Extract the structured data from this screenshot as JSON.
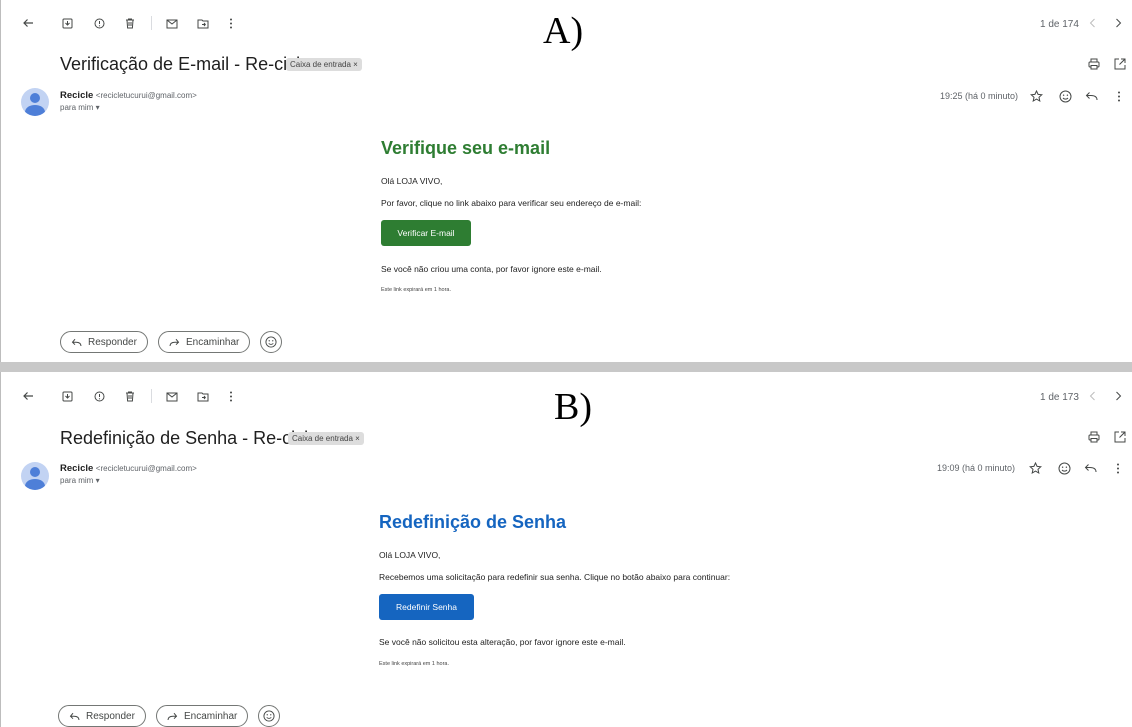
{
  "panels": [
    {
      "caption": "A)",
      "counter": "1 de 174",
      "subject": "Verificação de E-mail - Re-ciclo",
      "label": "Caixa de entrada ×",
      "sender_name": "Recicle",
      "sender_email": "<recicletucurui@gmail.com>",
      "to_me": "para mim ▾",
      "time": "19:25 (há 0 minuto)",
      "heading": "Verifique seu e-mail",
      "greeting": "Olá LOJA VIVO,",
      "instruction": "Por favor, clique no link abaixo para verificar seu endereço de e-mail:",
      "button": "Verificar E-mail",
      "ignore": "Se você não criou uma conta, por favor ignore este e-mail.",
      "expiry": "Este link expirará em 1 hora.",
      "reply": "Responder",
      "forward": "Encaminhar"
    },
    {
      "caption": "B)",
      "counter": "1 de 173",
      "subject": "Redefinição de Senha - Re-ciclo",
      "label": "Caixa de entrada ×",
      "sender_name": "Recicle",
      "sender_email": "<recicletucurui@gmail.com>",
      "to_me": "para mim ▾",
      "time": "19:09 (há 0 minuto)",
      "heading": "Redefinição de Senha",
      "greeting": "Olá LOJA VIVO,",
      "instruction": "Recebemos uma solicitação para redefinir sua senha. Clique no botão abaixo para continuar:",
      "button": "Redefinir Senha",
      "ignore": "Se você não solicitou esta alteração, por favor ignore este e-mail.",
      "expiry": "Este link expirará em 1 hora.",
      "reply": "Responder",
      "forward": "Encaminhar"
    }
  ],
  "colors": {
    "verify_green": "#2e7d32",
    "reset_blue": "#1565c0"
  },
  "icons": [
    "back-arrow-icon",
    "archive-icon",
    "report-spam-icon",
    "delete-icon",
    "mark-unread-icon",
    "move-to-icon",
    "more-vert-icon",
    "chevron-left-icon",
    "chevron-right-icon",
    "print-icon",
    "open-new-window-icon",
    "star-icon",
    "emoji-icon",
    "reply-icon"
  ]
}
